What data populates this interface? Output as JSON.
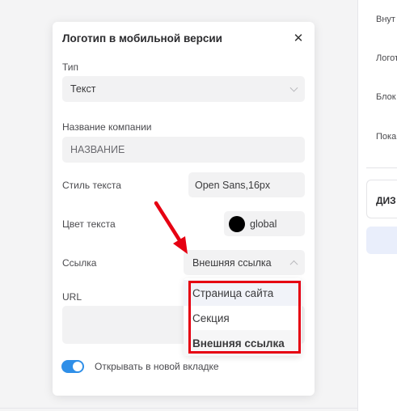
{
  "modal": {
    "title": "Логотип в мобильной версии",
    "close_icon": "✕",
    "type_label": "Тип",
    "type_value": "Текст",
    "company_label": "Название компании",
    "company_value": "НАЗВАНИЕ",
    "text_style_label": "Стиль текста",
    "text_style_value": "Open Sans,16px",
    "text_color_label": "Цвет текста",
    "text_color_value": "global",
    "text_color_swatch": "#000000",
    "link_label": "Ссылка",
    "link_value": "Внешняя ссылка",
    "url_label": "URL",
    "url_value": "",
    "new_tab_label": "Открывать в новой вкладке",
    "new_tab_enabled": true
  },
  "link_dropdown": {
    "options": [
      "Страница сайта",
      "Секция",
      "Внешняя ссылка"
    ],
    "selected": "Внешняя ссылка",
    "hovered": "Страница сайта"
  },
  "annotation": {
    "highlight_color": "#e60012",
    "arrow_color": "#e60012"
  },
  "right_panel": {
    "items": [
      "Внут",
      "Логот",
      "Блок",
      "Пока"
    ],
    "card_title": "ДИЗ"
  },
  "colors": {
    "toggle_on": "#2f8fe8",
    "field_bg": "#f2f2f3"
  }
}
